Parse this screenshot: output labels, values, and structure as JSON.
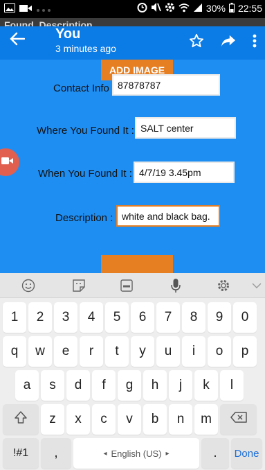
{
  "status_bar": {
    "battery": "30%",
    "time": "22:55"
  },
  "app": {
    "window_title": "Found_Description",
    "action_bar": {
      "title": "You",
      "subtitle": "3 minutes ago"
    },
    "add_image_label": "ADD IMAGE",
    "form": {
      "contact_label": "Contact Info :",
      "contact_value": "87878787",
      "where_label": "Where You Found It :",
      "where_value": "SALT center",
      "when_label": "When You Found It :",
      "when_value": "4/7/19 3.45pm",
      "description_label": "Description :",
      "description_value": "white and black bag."
    }
  },
  "keyboard": {
    "row_numbers": [
      "1",
      "2",
      "3",
      "4",
      "5",
      "6",
      "7",
      "8",
      "9",
      "0"
    ],
    "row_top": [
      "q",
      "w",
      "e",
      "r",
      "t",
      "y",
      "u",
      "i",
      "o",
      "p"
    ],
    "row_mid": [
      "a",
      "s",
      "d",
      "f",
      "g",
      "h",
      "j",
      "k",
      "l"
    ],
    "row_bottom": [
      "z",
      "x",
      "c",
      "v",
      "b",
      "n",
      "m"
    ],
    "symbols_key": "!#1",
    "comma_key": ",",
    "space_label": "English (US)",
    "period_key": ".",
    "done_key": "Done"
  },
  "colors": {
    "app_background": "#1f8ef2",
    "action_bar": "#0b7be6",
    "accent_orange": "#e67e22",
    "camera_fab": "#e15f4f"
  }
}
